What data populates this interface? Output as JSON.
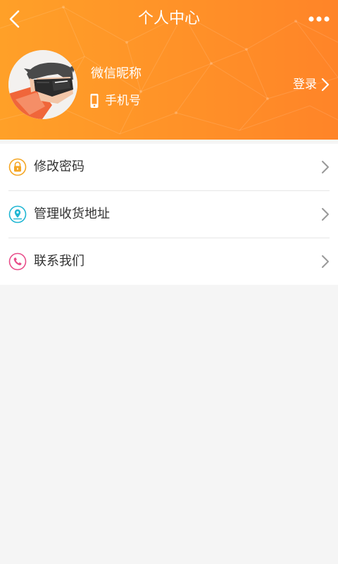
{
  "nav": {
    "title": "个人中心"
  },
  "profile": {
    "nickname": "微信昵称",
    "phone_label": "手机号",
    "login_label": "登录"
  },
  "menu": {
    "items": [
      {
        "label": "修改密码",
        "icon": "lock-icon",
        "color": "#f5a623"
      },
      {
        "label": "管理收货地址",
        "icon": "location-icon",
        "color": "#1fb6d3"
      },
      {
        "label": "联系我们",
        "icon": "phone-icon",
        "color": "#e84e8a"
      }
    ]
  },
  "colors": {
    "header_start": "#ffa028",
    "header_end": "#ff8428",
    "page_background": "#f5f5f5"
  }
}
